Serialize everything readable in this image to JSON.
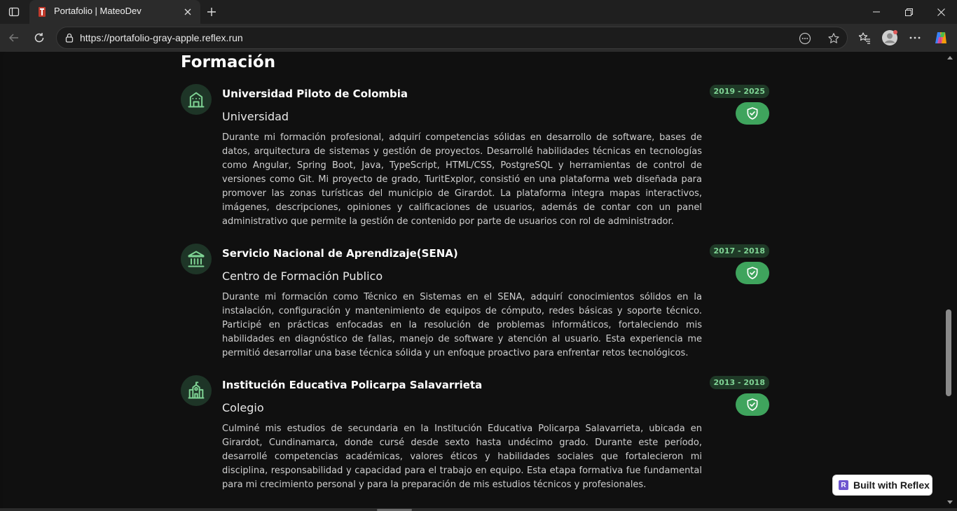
{
  "browser": {
    "tab": {
      "title": "Portafolio | MateoDev"
    },
    "address": {
      "url": "https://portafolio-gray-apple.reflex.run"
    }
  },
  "page": {
    "section_title": "Formación",
    "entries": [
      {
        "name": "Universidad Piloto de Colombia",
        "kind": "Universidad",
        "years": "2019 - 2025",
        "icon": "school-building-icon",
        "description": "Durante mi formación profesional, adquirí competencias sólidas en desarrollo de software, bases de datos, arquitectura de sistemas y gestión de proyectos. Desarrollé habilidades técnicas en tecnologías como Angular, Spring Boot, Java, TypeScript, HTML/CSS, PostgreSQL y herramientas de control de versiones como Git. Mi proyecto de grado, TuritExplor, consistió en una plataforma web diseñada para promover las zonas turísticas del municipio de Girardot. La plataforma integra mapas interactivos, imágenes, descripciones, opiniones y calificaciones de usuarios, además de contar con un panel administrativo que permite la gestión de contenido por parte de usuarios con rol de administrador."
      },
      {
        "name": "Servicio Nacional de Aprendizaje(SENA)",
        "kind": "Centro de Formación Publico",
        "years": "2017 - 2018",
        "icon": "landmark-icon",
        "description": "Durante mi formación como Técnico en Sistemas en el SENA, adquirí conocimientos sólidos en la instalación, configuración y mantenimiento de equipos de cómputo, redes básicas y soporte técnico. Participé en prácticas enfocadas en la resolución de problemas informáticos, fortaleciendo mis habilidades en diagnóstico de fallas, manejo de software y atención al usuario. Esta experiencia me permitió desarrollar una base técnica sólida y un enfoque proactivo para enfrentar retos tecnológicos."
      },
      {
        "name": "Institución Educativa Policarpa Salavarrieta",
        "kind": "Colegio",
        "years": "2013 - 2018",
        "icon": "school-icon",
        "description": "Culminé mis estudios de secundaria en la Institución Educativa Policarpa Salavarrieta, ubicada en Girardot, Cundinamarca, donde cursé desde sexto hasta undécimo grado. Durante este período, desarrollé competencias académicas, valores éticos y habilidades sociales que fortalecieron mi disciplina, responsabilidad y capacidad para el trabajo en equipo. Esta etapa formativa fue fundamental para mi crecimiento personal y para la preparación de mis estudios técnicos y profesionales."
      }
    ]
  },
  "reflex_badge": {
    "label": "Built with Reflex",
    "logo_letter": "R"
  },
  "colors": {
    "accent": "#3fa45d",
    "icon_green": "#7fd394",
    "background": "#101010"
  }
}
